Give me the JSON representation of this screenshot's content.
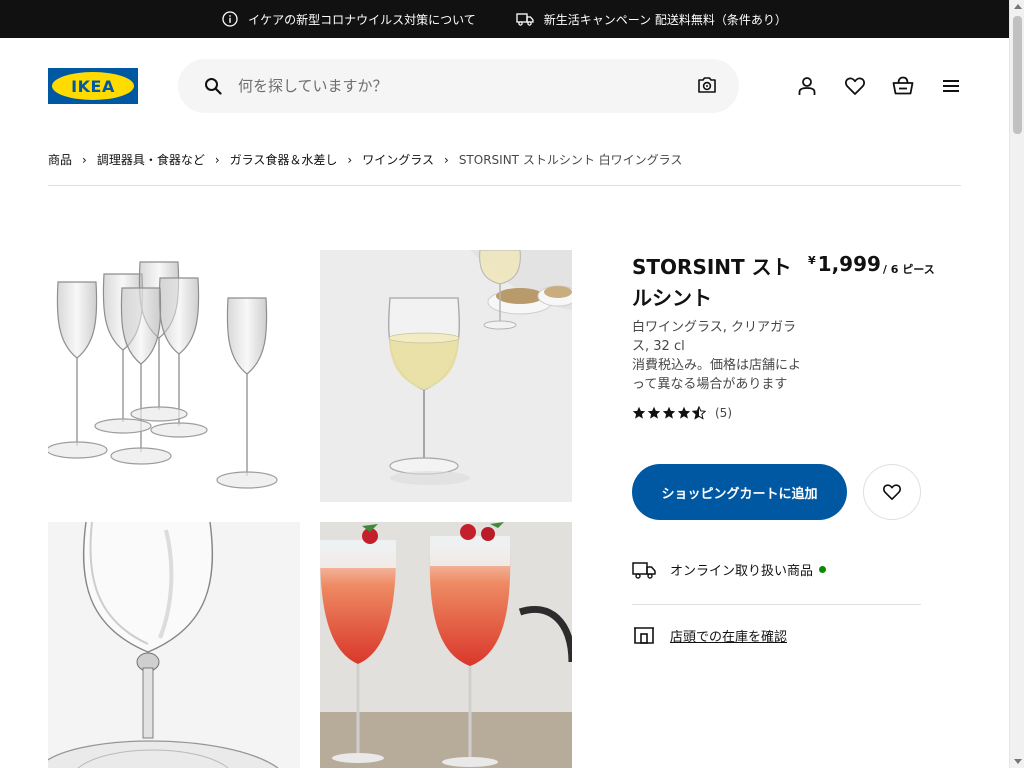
{
  "banner": {
    "covid_text": "イケアの新型コロナウイルス対策について",
    "covid_icon": "info-icon",
    "campaign_text": "新生活キャンペーン 配送料無料（条件あり）",
    "campaign_icon": "truck-icon"
  },
  "header": {
    "logo_text": "IKEA",
    "search_placeholder": "何を探していますか？",
    "icons": [
      "user-icon",
      "heart-icon",
      "cart-icon",
      "menu-icon"
    ]
  },
  "breadcrumb": {
    "items": [
      "商品",
      "調理器具・食器など",
      "ガラス食器＆水差し",
      "ワイングラス"
    ],
    "current": "STORSINT ストルシント 白ワイングラス",
    "separator": "›"
  },
  "product": {
    "name": "STORSINT ストルシント",
    "price_currency": "¥",
    "price_amount": "1,999",
    "price_unit": "/ 6 ピース",
    "description_line1": "白ワイングラス, クリアガラス, 32 cl",
    "description_line2": "消費税込み。価格は店舗によって異なる場合があります",
    "rating_stars": 4.5,
    "rating_count": "(5)",
    "add_to_cart_label": "ショッピングカートに追加",
    "availability_text": "オンライン取り扱い商品",
    "store_stock_text": "店頭での在庫を確認"
  },
  "colors": {
    "ikea_blue": "#0058a3",
    "ikea_yellow": "#ffdb00",
    "available_green": "#0a8a00",
    "banner_bg": "#111111"
  }
}
